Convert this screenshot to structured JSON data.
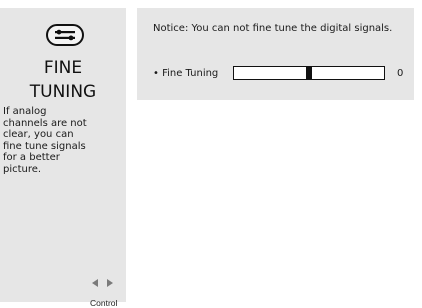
{
  "sidebar": {
    "icon": "wrench-settings-icon",
    "title_line1": "FINE",
    "title_line2": "TUNING",
    "description": "If analog\nchannels are not\nclear, you can\nfine tune signals\nfor a better\npicture.",
    "control_label": "Control"
  },
  "panel": {
    "notice": "Notice:  You can not fine tune the digital signals.",
    "setting": {
      "label": "• Fine Tuning",
      "value": "0",
      "level": 0.5
    }
  }
}
